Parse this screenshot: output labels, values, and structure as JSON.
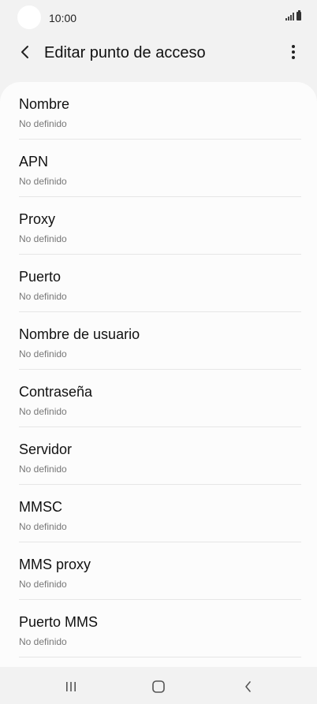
{
  "status_bar": {
    "time": "10:00"
  },
  "header": {
    "title": "Editar punto de acceso"
  },
  "settings": {
    "items": [
      {
        "title": "Nombre",
        "value": "No definido"
      },
      {
        "title": "APN",
        "value": "No definido"
      },
      {
        "title": "Proxy",
        "value": "No definido"
      },
      {
        "title": "Puerto",
        "value": "No definido"
      },
      {
        "title": "Nombre de usuario",
        "value": "No definido"
      },
      {
        "title": "Contraseña",
        "value": "No definido"
      },
      {
        "title": "Servidor",
        "value": "No definido"
      },
      {
        "title": "MMSC",
        "value": "No definido"
      },
      {
        "title": "MMS proxy",
        "value": "No definido"
      },
      {
        "title": "Puerto MMS",
        "value": "No definido"
      }
    ]
  },
  "nav_bar": {
    "icons": [
      "recents-icon",
      "home-icon",
      "back-icon"
    ]
  },
  "colors": {
    "background": "#f2f2f2",
    "card": "#fcfcfc",
    "text_primary": "#111111",
    "text_secondary": "#777777"
  }
}
